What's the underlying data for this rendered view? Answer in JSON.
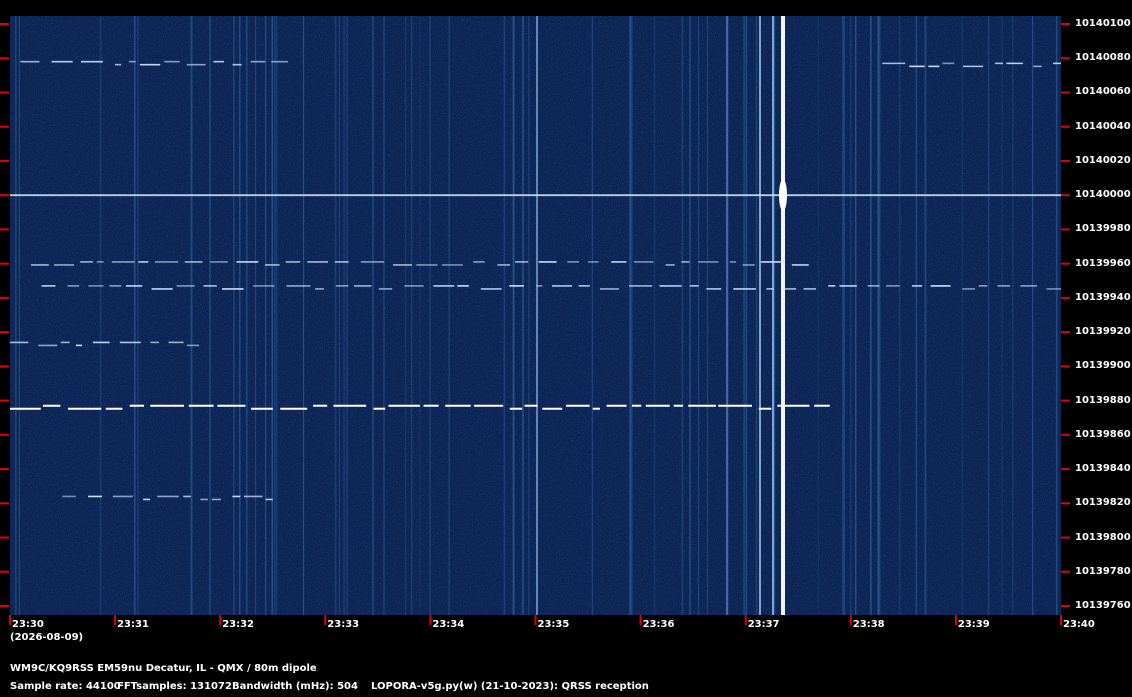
{
  "chart_data": {
    "type": "heatmap",
    "title": "",
    "xlabel": "",
    "ylabel": "",
    "x_ticks": [
      "23:30",
      "23:31",
      "23:32",
      "23:33",
      "23:34",
      "23:35",
      "23:36",
      "23:37",
      "23:38",
      "23:39",
      "23:40"
    ],
    "date_label": "(2026-08-09)",
    "y_ticks": [
      "10140100",
      "10140080",
      "10140060",
      "10140040",
      "10140020",
      "10140000",
      "10139980",
      "10139960",
      "10139940",
      "10139920",
      "10139900",
      "10139880",
      "10139860",
      "10139840",
      "10139820",
      "10139800",
      "10139780",
      "10139760"
    ],
    "xlim": [
      "23:30",
      "23:40"
    ],
    "ylim": [
      10139760,
      10140100
    ],
    "colormap": [
      "#0a1f4e",
      "#1e4d8c",
      "#ffffff"
    ],
    "carrier_frequency": 10140000,
    "signals": [
      {
        "freq": 10139877,
        "start": "23:30",
        "end": "23:37.8"
      },
      {
        "freq": 10139914,
        "start": "23:30",
        "end": "23:31.8"
      },
      {
        "freq": 10139824,
        "start": "23:30.5",
        "end": "23:32.5"
      },
      {
        "freq": 10139961,
        "start": "23:30.2",
        "end": "23:37.6"
      },
      {
        "freq": 10139947,
        "start": "23:30.3",
        "end": "23:40"
      },
      {
        "freq": 10140078,
        "start": "23:30.1",
        "end": "23:32.7"
      },
      {
        "freq": 10140077,
        "start": "23:38.3",
        "end": "23:40"
      }
    ]
  },
  "info": {
    "station": "WM9C/KQ9RSS EM59nu Decatur, IL - QMX / 80m dipole",
    "sample_rate": "Sample rate: 44100",
    "fft_samples": "FFTsamples: 131072",
    "bandwidth": "Bandwidth (mHz): 504",
    "software": "LOPORA-v5g.py(w) (21-10-2023): QRSS reception"
  },
  "colors": {
    "tick": "#e00000",
    "background": "#000000",
    "text": "#ffffff"
  }
}
